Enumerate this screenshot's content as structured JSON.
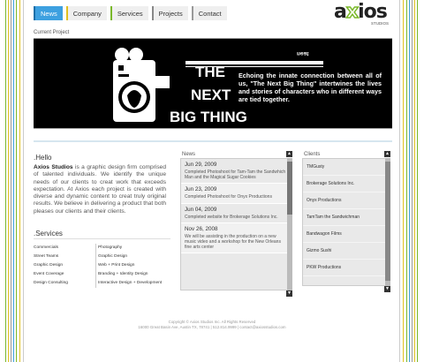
{
  "nav": {
    "items": [
      {
        "label": "News",
        "active": true,
        "bar_color": "#1d6fa8"
      },
      {
        "label": "Company",
        "active": false,
        "bar_color": "#e0c020"
      },
      {
        "label": "Services",
        "active": false,
        "bar_color": "#7ab82a"
      },
      {
        "label": "Projects",
        "active": false,
        "bar_color": "#888888"
      },
      {
        "label": "Contact",
        "active": false,
        "bar_color": "#999999"
      }
    ]
  },
  "logo": {
    "word": "axios",
    "tagline": "STUDIOS"
  },
  "current_project": {
    "label": "Current Project",
    "title_the": "THE",
    "title_next": "NEXT",
    "title_big": "BIG THING",
    "flipped_text": "neat",
    "tagline": "Echoing the innate connection between all of us, \"The Next Big Thing\" intertwines the lives and stories of characters who in different ways are tied together."
  },
  "hello": {
    "heading": ".Hello",
    "company": "Axios Studios",
    "body": " is a graphic design firm comprised of talented individuals. We identify the unique needs of our clients to creat work that exceeds expectation. At Axios each project is created with diverse and dynamic content to creat truly original results. We believe in delivering a product that both pleases our clients and their clients."
  },
  "services": {
    "heading": ".Services",
    "col1": [
      "Commercials",
      "Street Teams",
      "Graphic Design",
      "Event Coverage",
      "Design Consulting"
    ],
    "col2": [
      "Photography",
      "Graphic Design",
      "Web + Print Design",
      "Branding + Identity Design",
      "Interactive Design + Development"
    ]
  },
  "news": {
    "label": "News",
    "items": [
      {
        "date": "Jun 29, 2009",
        "desc": "Completed Photoshoot for Tam-Tam the Sandwhich Man and the Magical Sugar Cookies"
      },
      {
        "date": "Jun 23, 2009",
        "desc": "Completed Photoshoot for Onyx Productions"
      },
      {
        "date": "Jun 04, 2009",
        "desc": "Completed website for Brokerage Solutions Inc."
      },
      {
        "date": "Nov 26, 2008",
        "desc": "We will be assisting in the production on a new music video and a workshop for the New Orleans fine arts center"
      }
    ]
  },
  "clients": {
    "label": "Clients",
    "items": [
      "TMGusty",
      "Brokerage Solutions Inc.",
      "Onyx Productions",
      "TamTam the Sandwichman",
      "Bandwagon Films",
      "Gizmo Sushi",
      "PKW Productions"
    ]
  },
  "footer": {
    "line1": "Copyright © Axios Studios Inc. All Rights Reserved",
    "line2": "16000 Great Basin Ave, Austin TX, 78741 | 512.814.9999 | contact@axiosstudios.com"
  },
  "icons": {
    "scroll_up": "up-arrow-icon",
    "scroll_down": "down-arrow-icon",
    "camera": "camera-icon"
  },
  "colors": {
    "accent_blue": "#3da0e0",
    "stripe_yellow": "#e0c020",
    "stripe_green": "#7ab82a",
    "stripe_gray": "#999999"
  }
}
